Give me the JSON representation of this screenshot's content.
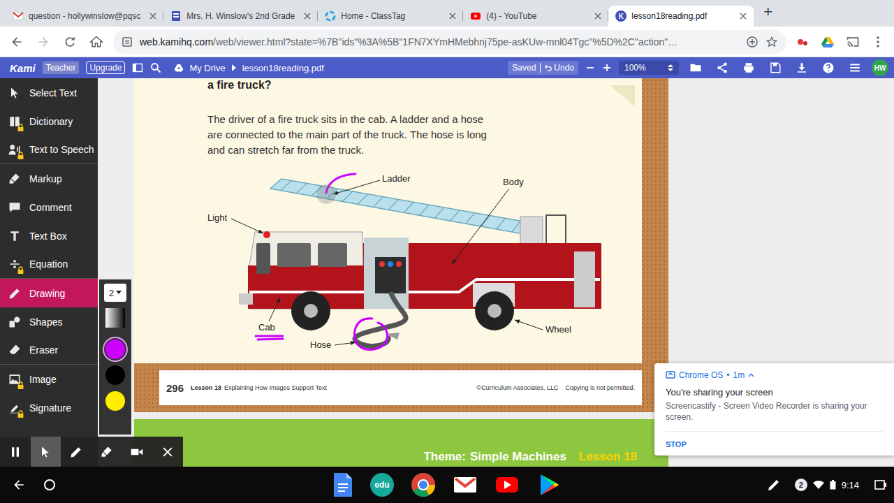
{
  "browser": {
    "tabs": [
      {
        "label": "question - hollywinslow@pqsc",
        "selected": false
      },
      {
        "label": "Mrs. H. Winslow's 2nd Grade",
        "selected": false
      },
      {
        "label": "Home - ClassTag",
        "selected": false
      },
      {
        "label": "(4) - YouTube",
        "selected": false
      },
      {
        "label": "lesson18reading.pdf",
        "selected": true,
        "icon_text": "K"
      }
    ],
    "new_tab": "+",
    "back_enabled": true,
    "forward_enabled": false,
    "url_host": "web.kamihq.com",
    "url_path": "/web/viewer.html?state=%7B\"ids\"%3A%5B\"1FN7XYmHMebhnj75pe-asKUw-mnl04Tgc\"%5D%2C\"action\"…"
  },
  "kami": {
    "logo": "Kami",
    "role": "Teacher",
    "upgrade": "Upgrade",
    "path": [
      "My Drive",
      "lesson18reading.pdf"
    ],
    "saved": "Saved",
    "undo": "Undo",
    "zoom": "100%",
    "avatar": "HW"
  },
  "tools": [
    {
      "label": "Select Text",
      "locked": false,
      "selected": false
    },
    {
      "label": "Dictionary",
      "locked": true,
      "selected": false
    },
    {
      "label": "Text to Speech",
      "locked": true,
      "selected": false
    },
    {
      "label": "Markup",
      "locked": false,
      "selected": false
    },
    {
      "label": "Comment",
      "locked": false,
      "selected": false
    },
    {
      "label": "Text Box",
      "locked": false,
      "selected": false
    },
    {
      "label": "Equation",
      "locked": true,
      "selected": false
    },
    {
      "label": "Drawing",
      "locked": false,
      "selected": true
    },
    {
      "label": "Shapes",
      "locked": false,
      "selected": false
    },
    {
      "label": "Eraser",
      "locked": false,
      "selected": false
    },
    {
      "label": "Image",
      "locked": true,
      "selected": false
    },
    {
      "label": "Signature",
      "locked": true,
      "selected": false
    }
  ],
  "drawing_panel": {
    "thickness": "2",
    "colors": [
      {
        "color": "#cc00ff",
        "selected": true
      },
      {
        "color": "#000000",
        "selected": false
      },
      {
        "color": "#ffee00",
        "selected": false
      }
    ]
  },
  "document": {
    "heading": "a fire truck?",
    "lines": [
      "The driver of a fire truck sits in the cab. A ladder and a hose",
      "are connected to the main part of the truck. The hose is long",
      "and can stretch far from the truck."
    ],
    "labels": [
      "Ladder",
      "Body",
      "Light",
      "Cab",
      "Hose",
      "Wheel"
    ],
    "page_number": "296",
    "lesson": "Lesson 18",
    "lesson_title": "Explaining How Images Support Text",
    "copyright": "©Curriculum Associates, LLC",
    "notice": "Copying is not permitted.",
    "theme_label": "Theme:",
    "theme": "Simple Machines",
    "theme_lesson": "Lesson 18"
  },
  "recorder": {
    "tools": [
      {
        "selected": false
      },
      {
        "selected": true
      },
      {
        "selected": false
      },
      {
        "selected": false
      },
      {
        "selected": false
      },
      {
        "selected": false
      }
    ]
  },
  "notification": {
    "app": "Chrome OS",
    "separator": "•",
    "time": "1m",
    "title": "You're sharing your screen",
    "body": "Screencastify - Screen Video Recorder is sharing your screen.",
    "action": "STOP"
  },
  "shelf": {
    "edu_label": "edu",
    "badge": "2",
    "time": "9:14"
  }
}
